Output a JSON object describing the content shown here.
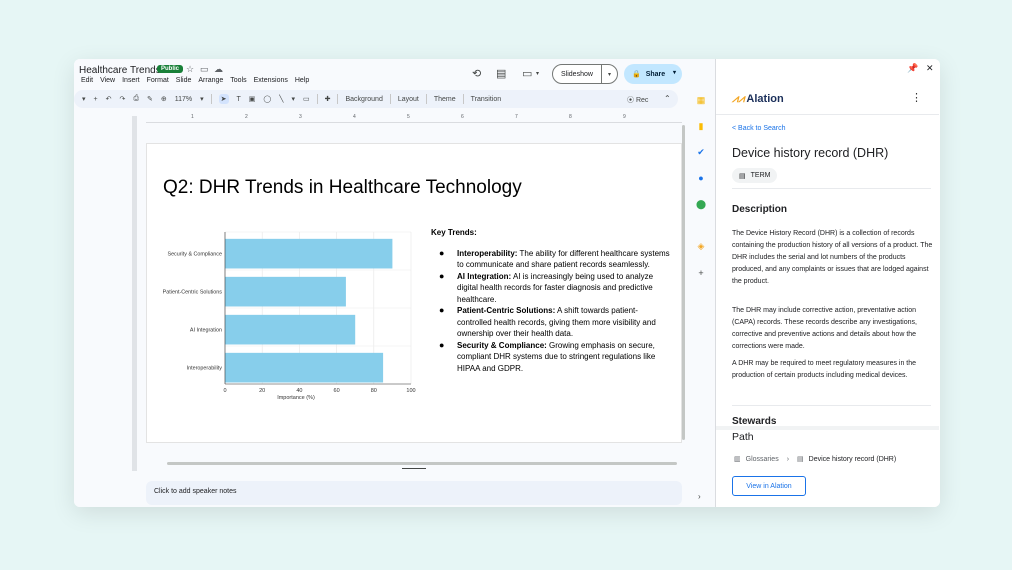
{
  "slides_app": {
    "doc_title": "Healthcare Trends",
    "badge": "Public",
    "menu": [
      "Edit",
      "View",
      "Insert",
      "Format",
      "Slide",
      "Arrange",
      "Tools",
      "Extensions",
      "Help"
    ],
    "slideshow_label": "Slideshow",
    "share_label": "Share",
    "toolbar": {
      "zoom": "117%",
      "background": "Background",
      "layout": "Layout",
      "theme": "Theme",
      "transition": "Transition",
      "rec": "Rec"
    },
    "ruler_ticks": [
      "1",
      "2",
      "3",
      "4",
      "5",
      "6",
      "7",
      "8",
      "9"
    ],
    "speaker_notes_placeholder": "Click to add speaker notes"
  },
  "slide": {
    "title": "Q2: DHR Trends in Healthcare Technology",
    "key_trends_heading": "Key Trends:",
    "trends": [
      {
        "name": "Interoperability:",
        "text": " The ability for different healthcare systems to communicate and share patient records seamlessly."
      },
      {
        "name": "AI Integration:",
        "text": " AI is increasingly being used to analyze digital health records for faster diagnosis and predictive healthcare."
      },
      {
        "name": "Patient-Centric Solutions:",
        "text": " A shift towards patient-controlled health records, giving them more visibility and ownership over their health data."
      },
      {
        "name": "Security & Compliance:",
        "text": " Growing emphasis on secure, compliant DHR systems due to stringent regulations like HIPAA and GDPR."
      }
    ]
  },
  "chart_data": {
    "type": "bar",
    "orientation": "horizontal",
    "categories": [
      "Security & Compliance",
      "Patient-Centric Solutions",
      "AI Integration",
      "Interoperability"
    ],
    "values": [
      90,
      65,
      70,
      85
    ],
    "xlabel": "Importance (%)",
    "ylabel": "",
    "xlim": [
      0,
      100
    ],
    "xticks": [
      "0",
      "20",
      "40",
      "60",
      "80",
      "100"
    ],
    "bar_color": "#87ceeb",
    "grid": true
  },
  "alation": {
    "logo_text": "Alation",
    "back_link": "< Back to Search",
    "title": "Device history record (DHR)",
    "term_chip": "TERM",
    "description_heading": "Description",
    "description_paragraphs": [
      "The Device History Record (DHR) is a collection of records containing the production history of all versions of a product. The DHR includes the serial and lot numbers of the products produced, and any complaints or issues that are lodged against the product.",
      "The DHR may include corrective action, preventative action (CAPA) records. These records describe any investigations, corrective and preventive actions and details about how the corrections were made.",
      "A DHR may be required to meet regulatory measures in the production of certain products including medical devices."
    ],
    "stewards_heading": "Stewards",
    "path_heading": "Path",
    "path": [
      "Glossaries",
      "Device history record (DHR)"
    ],
    "view_button": "View in Alation"
  },
  "colors": {
    "share_bg": "#c2e7ff",
    "badge_green": "#188038",
    "link_blue": "#1a73e8",
    "alation_orange": "#f3a623",
    "alation_navy": "#1b2f5a"
  }
}
